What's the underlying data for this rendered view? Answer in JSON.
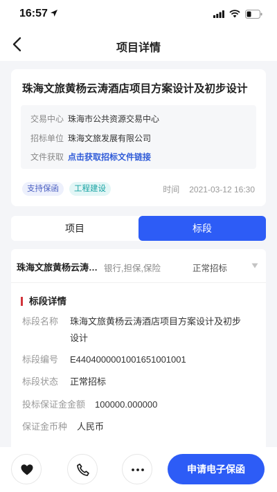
{
  "status_bar": {
    "time": "16:57"
  },
  "nav": {
    "title": "项目详情"
  },
  "project": {
    "title": "珠海文旅黄杨云涛酒店项目方案设计及初步设计",
    "info": [
      {
        "label": "交易中心",
        "value": "珠海市公共资源交易中心"
      },
      {
        "label": "招标单位",
        "value": "珠海文旅发展有限公司"
      },
      {
        "label": "文件获取",
        "value": "点击获取招标文件链接"
      }
    ],
    "tags": [
      "支持保函",
      "工程建设"
    ],
    "time_label": "时间",
    "time_value": "2021-03-12 16:30"
  },
  "tabs": [
    {
      "label": "项目",
      "active": false
    },
    {
      "label": "标段",
      "active": true
    }
  ],
  "section": {
    "name": "珠海文旅黄杨云涛酒店项目方案设计及初步设计",
    "tags": "银行,担保,保险",
    "status": "正常招标"
  },
  "details": {
    "heading": "标段详情",
    "rows": [
      {
        "label": "标段名称",
        "value": "珠海文旅黄杨云涛酒店项目方案设计及初步",
        "value2": "设计"
      },
      {
        "label": "标段编号",
        "value": "E4404000001001651001001"
      },
      {
        "label": "标段状态",
        "value": "正常招标"
      },
      {
        "label": "投标保证金金额",
        "value": "100000.000000"
      },
      {
        "label": "保证金币种",
        "value": "人民币"
      }
    ]
  },
  "bottom": {
    "guarantee_label": "申请电子保函"
  },
  "colors": {
    "primary": "#2d5cf6",
    "accent_red": "#d2343b",
    "link": "#2f5bd8"
  }
}
